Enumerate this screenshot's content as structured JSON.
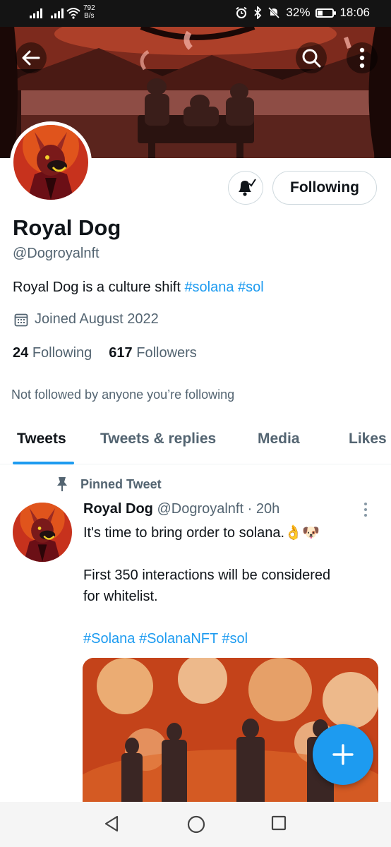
{
  "status_bar": {
    "network_speed": "792",
    "network_unit": "B/s",
    "battery": "32%",
    "battery_level": 0.32,
    "time": "18:06"
  },
  "profile": {
    "name": "Royal Dog",
    "handle": "@Dogroyalnft",
    "bio_text": "Royal Dog is a culture shift ",
    "bio_tags": "#solana #sol",
    "joined": "Joined August 2022",
    "following_count": "24",
    "following_label": "Following",
    "followers_count": "617",
    "followers_label": "Followers",
    "follow_button_label": "Following",
    "not_followed_text": "Not followed by anyone you’re following"
  },
  "tabs": [
    {
      "label": "Tweets",
      "active": true
    },
    {
      "label": "Tweets & replies",
      "active": false
    },
    {
      "label": "Media",
      "active": false
    },
    {
      "label": "Likes",
      "active": false
    }
  ],
  "pinned_tweet": {
    "pinned_label": "Pinned Tweet",
    "author_name": "Royal Dog",
    "author_handle": "@Dogroyalnft",
    "separator": "·",
    "time": "20h",
    "line1": "It's time to bring order to solana.👌🐶",
    "line2": "First 350 interactions will be considered",
    "line3": "for whitelist.",
    "hashtags": "#Solana #SolanaNFT #sol"
  },
  "colors": {
    "accent": "#1d9bf0",
    "text_primary": "#0f1419",
    "text_secondary": "#536471",
    "status_bar": "#141414"
  },
  "icons": {
    "back": "arrow-left-icon",
    "search": "search-icon",
    "more": "more-vertical-icon",
    "notifications": "bell-check-icon",
    "calendar": "calendar-icon",
    "pin": "pin-icon",
    "compose": "plus-icon",
    "nav_back": "triangle-back-icon",
    "nav_home": "circle-home-icon",
    "nav_recent": "square-recent-icon"
  }
}
